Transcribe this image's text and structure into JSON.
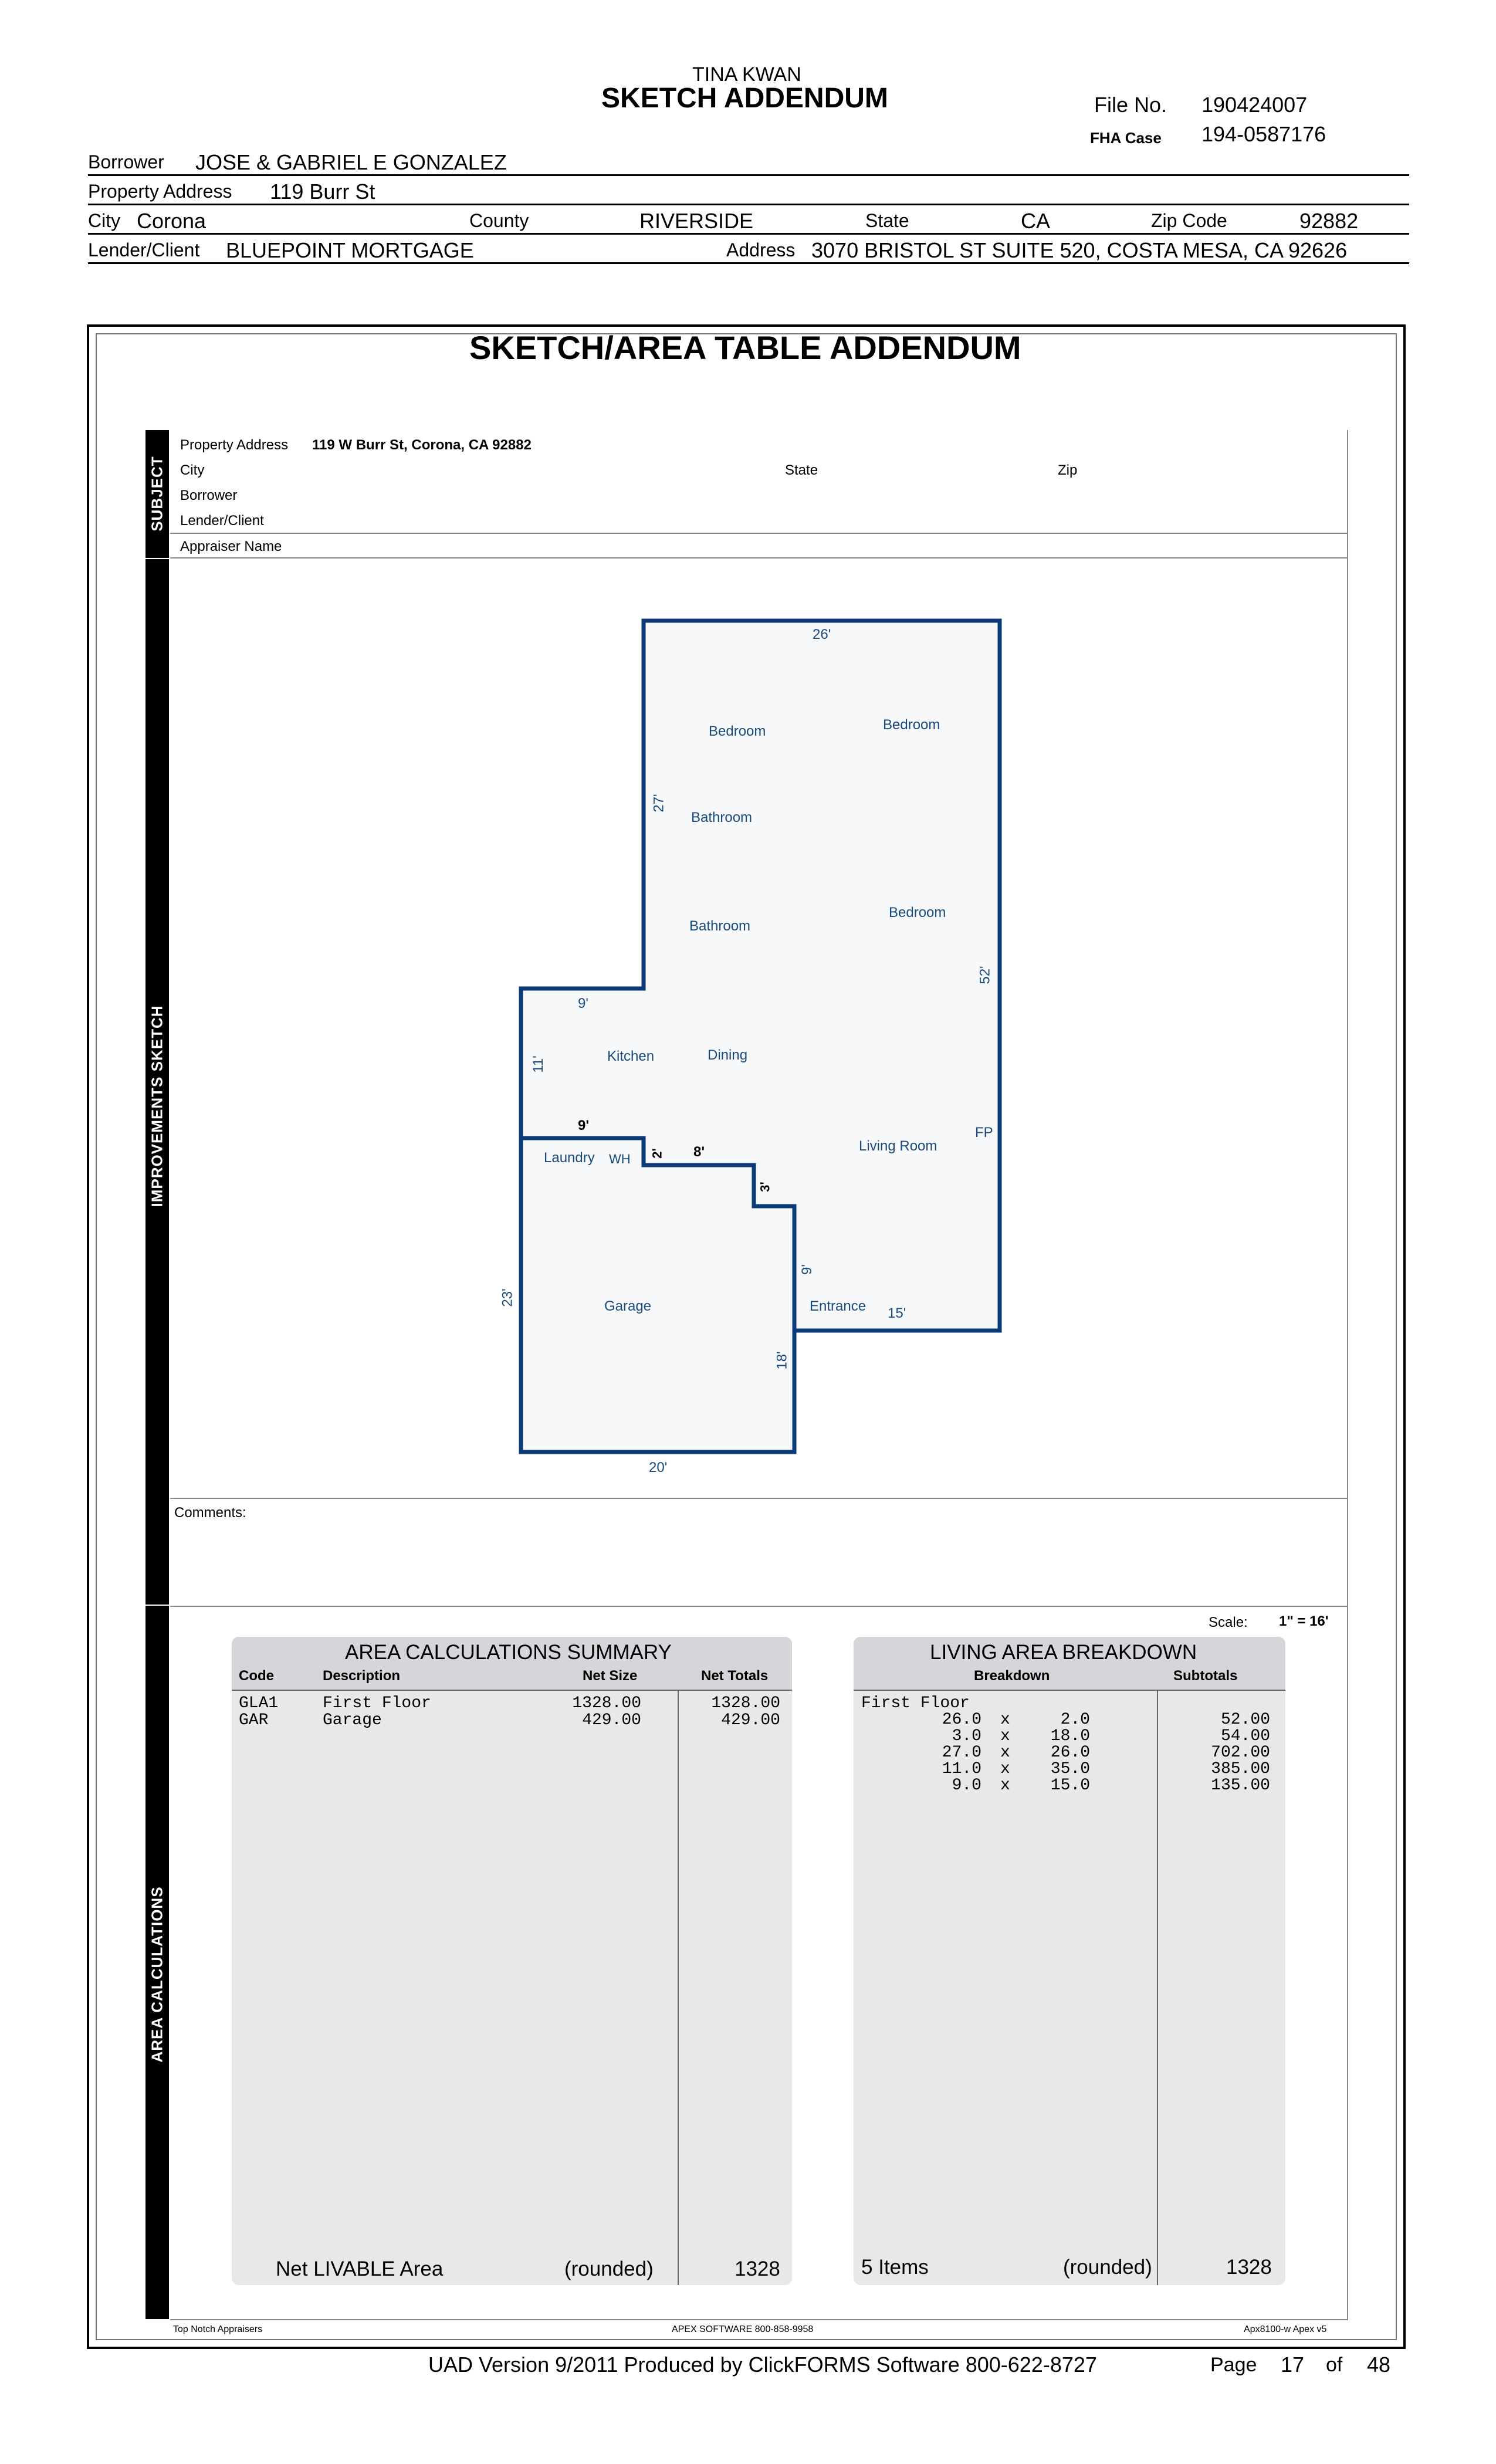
{
  "header": {
    "appraiser": "TINA KWAN",
    "title": "SKETCH ADDENDUM",
    "file_no_label": "File No.",
    "file_no": "190424007",
    "fha_label": "FHA Case",
    "fha_case": "194-0587176"
  },
  "info": {
    "borrower_label": "Borrower",
    "borrower": "JOSE & GABRIEL E GONZALEZ",
    "property_label": "Property Address",
    "property": "119 Burr St",
    "city_label": "City",
    "city": "Corona",
    "county_label": "County",
    "county": "RIVERSIDE",
    "state_label": "State",
    "state": "CA",
    "zip_label": "Zip Code",
    "zip": "92882",
    "lender_label": "Lender/Client",
    "lender": "BLUEPOINT MORTGAGE",
    "address_label": "Address",
    "address": "3070 BRISTOL ST SUITE 520, COSTA MESA, CA 92626"
  },
  "form": {
    "title": "SKETCH/AREA TABLE ADDENDUM",
    "side_subject": "SUBJECT",
    "side_sketch": "IMPROVEMENTS SKETCH",
    "side_area": "AREA CALCULATIONS",
    "subject": {
      "property_label": "Property Address",
      "property": "119 W Burr St, Corona, CA 92882",
      "city_label": "City",
      "state_label": "State",
      "zip_label": "Zip",
      "borrower_label": "Borrower",
      "lender_label": "Lender/Client",
      "appraiser_label": "Appraiser Name"
    },
    "comments_label": "Comments:",
    "scale_label": "Scale:",
    "scale": "1\" = 16'",
    "footer_left": "Top Notch Appraisers",
    "footer_center": "APEX SOFTWARE 800-858-9958",
    "footer_right": "Apx8100-w Apex v5"
  },
  "sketch": {
    "rooms": {
      "bedroom1": "Bedroom",
      "bedroom2": "Bedroom",
      "bedroom3": "Bedroom",
      "bathroom1": "Bathroom",
      "bathroom2": "Bathroom",
      "kitchen": "Kitchen",
      "dining": "Dining",
      "living": "Living Room",
      "fp": "FP",
      "laundry": "Laundry",
      "wh": "WH",
      "garage": "Garage",
      "entrance": "Entrance"
    },
    "dims": {
      "top": "26'",
      "left_upper": "27'",
      "right": "52'",
      "step_top": "9'",
      "kitchen_h": "11'",
      "step_mid": "9'",
      "notch_v": "2'",
      "notch_h": "8'",
      "step_v": "3'",
      "entry_v": "9'",
      "entry_h": "15'",
      "garage_left": "23'",
      "garage_right": "18'",
      "bottom": "20'"
    }
  },
  "summary": {
    "title": "AREA  CALCULATIONS  SUMMARY",
    "col_code": "Code",
    "col_desc": "Description",
    "col_net": "Net Size",
    "col_totals": "Net Totals",
    "rows": [
      {
        "code": "GLA1",
        "desc": "First Floor",
        "net": "1328.00",
        "total": "1328.00"
      },
      {
        "code": "GAR",
        "desc": "Garage",
        "net": "429.00",
        "total": "429.00"
      }
    ],
    "footer_label": "Net LIVABLE Area",
    "footer_rounded": "(rounded)",
    "footer_value": "1328"
  },
  "breakdown": {
    "title": "LIVING  AREA  BREAKDOWN",
    "col_breakdown": "Breakdown",
    "col_subtotals": "Subtotals",
    "floor": "First Floor",
    "rows": [
      {
        "a": "26.0",
        "x": "x",
        "b": "2.0",
        "sub": "52.00"
      },
      {
        "a": "3.0",
        "x": "x",
        "b": "18.0",
        "sub": "54.00"
      },
      {
        "a": "27.0",
        "x": "x",
        "b": "26.0",
        "sub": "702.00"
      },
      {
        "a": "11.0",
        "x": "x",
        "b": "35.0",
        "sub": "385.00"
      },
      {
        "a": "9.0",
        "x": "x",
        "b": "15.0",
        "sub": "135.00"
      }
    ],
    "footer_items": "5 Items",
    "footer_rounded": "(rounded)",
    "footer_value": "1328"
  },
  "page_footer": {
    "uad": "UAD Version 9/2011 Produced by ClickFORMS Software 800-622-8727",
    "page_label": "Page",
    "page": "17",
    "of_label": "of",
    "total": "48"
  }
}
